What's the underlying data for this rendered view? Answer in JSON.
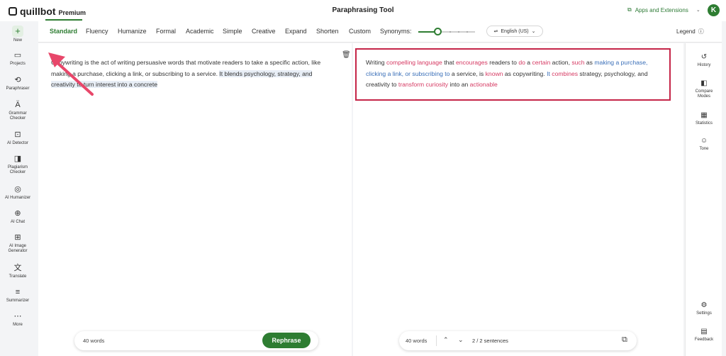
{
  "topbar": {
    "logo_word": "quillbot",
    "logo_tier": "Premium",
    "title": "Paraphrasing Tool",
    "apps_label": "Apps and Extensions",
    "avatar_initial": "K"
  },
  "sidebar": {
    "new_label": "New",
    "items": [
      {
        "label": "Projects",
        "icon": "folder-icon"
      },
      {
        "label": "Paraphraser",
        "icon": "paraphraser-icon"
      },
      {
        "label": "Grammar Checker",
        "icon": "grammar-icon"
      },
      {
        "label": "AI Detector",
        "icon": "ai-detector-icon"
      },
      {
        "label": "Plagiarism Checker",
        "icon": "plagiarism-icon"
      },
      {
        "label": "AI Humanizer",
        "icon": "humanizer-icon"
      },
      {
        "label": "AI Chat",
        "icon": "chat-icon"
      },
      {
        "label": "AI Image Generator",
        "icon": "image-generator-icon"
      },
      {
        "label": "Translate",
        "icon": "translate-icon"
      },
      {
        "label": "Summarizer",
        "icon": "summarizer-icon"
      },
      {
        "label": "More",
        "icon": "more-icon"
      }
    ]
  },
  "modes": {
    "items": [
      "Standard",
      "Fluency",
      "Humanize",
      "Formal",
      "Academic",
      "Simple",
      "Creative",
      "Expand",
      "Shorten",
      "Custom"
    ],
    "active": "Standard",
    "synonyms_label": "Synonyms:",
    "synonyms_level": 0.3,
    "language": "English (US)",
    "legend_label": "Legend"
  },
  "input": {
    "plain": "Copywriting is the act of writing persuasive words that motivate readers to take a specific action, like making a purchase, clicking a link, or subscribing to a service. ",
    "highlighted": "It blends psychology, strategy, and creativity to turn interest into a concrete",
    "word_count": "40 words",
    "rephrase_label": "Rephrase"
  },
  "output": {
    "segments": [
      {
        "text": "Writing ",
        "style": "plain"
      },
      {
        "text": "compelling language",
        "style": "red"
      },
      {
        "text": " that ",
        "style": "plain"
      },
      {
        "text": "encourages",
        "style": "red"
      },
      {
        "text": " readers to ",
        "style": "plain"
      },
      {
        "text": "do",
        "style": "red"
      },
      {
        "text": " a ",
        "style": "plain"
      },
      {
        "text": "certain",
        "style": "red"
      },
      {
        "text": " action, ",
        "style": "plain"
      },
      {
        "text": "such",
        "style": "red"
      },
      {
        "text": " as ",
        "style": "plain"
      },
      {
        "text": "making a purchase, clicking a link, or subscribing to",
        "style": "blue"
      },
      {
        "text": " a service, is ",
        "style": "plain"
      },
      {
        "text": "known",
        "style": "red"
      },
      {
        "text": " as copywriting. ",
        "style": "plain"
      },
      {
        "text": "It",
        "style": "blue"
      },
      {
        "text": " ",
        "style": "plain"
      },
      {
        "text": "combines",
        "style": "red"
      },
      {
        "text": " strategy, psychology, and creativity to ",
        "style": "plain"
      },
      {
        "text": "transform curiosity",
        "style": "red"
      },
      {
        "text": " into an ",
        "style": "plain"
      },
      {
        "text": "actionable",
        "style": "red"
      }
    ],
    "word_count": "40 words",
    "sentences": "2 / 2 sentences"
  },
  "rail": {
    "items": [
      {
        "label": "History",
        "icon": "history-icon"
      },
      {
        "label": "Compare Modes",
        "icon": "compare-icon"
      },
      {
        "label": "Statistics",
        "icon": "statistics-icon"
      },
      {
        "label": "Tone",
        "icon": "tone-icon"
      }
    ],
    "bottom": [
      {
        "label": "Settings",
        "icon": "settings-icon"
      },
      {
        "label": "Feedback",
        "icon": "feedback-icon"
      }
    ]
  },
  "colors": {
    "accent": "#2e7d32",
    "changed_word": "#d63a63",
    "structural_change": "#3a6fb8",
    "annotation": "#e8476a",
    "highlight_box": "#c52548"
  }
}
